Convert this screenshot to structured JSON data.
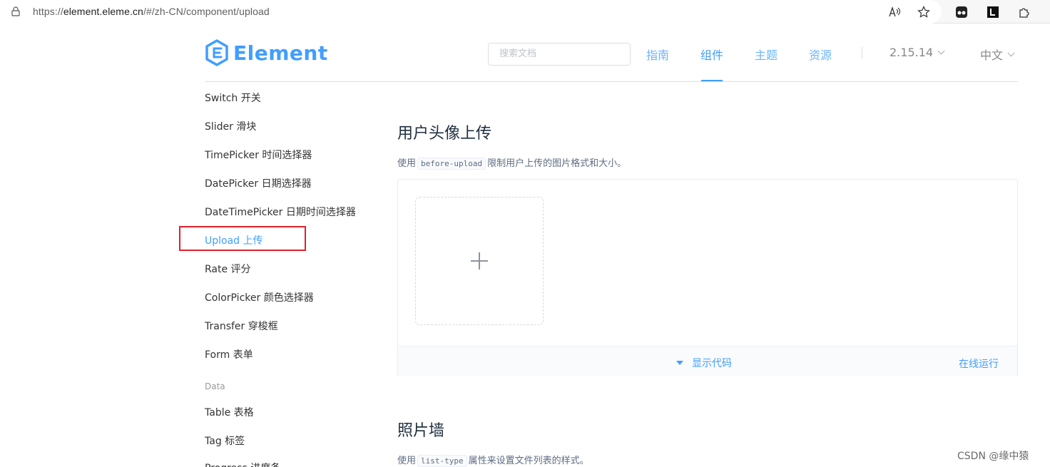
{
  "browser": {
    "url_prefix": "https://",
    "url_host": "element.eleme.cn",
    "url_path": "/#/zh-CN/component/upload",
    "icons": [
      "lock-icon",
      "read-aloud-icon",
      "favorite-star-icon",
      "extension-icon",
      "extension-icon",
      "puzzle-extension-icon"
    ]
  },
  "header": {
    "logo_text": "Element",
    "search_placeholder": "搜索文档",
    "nav": [
      {
        "label": "指南"
      },
      {
        "label": "组件"
      },
      {
        "label": "主题"
      },
      {
        "label": "资源"
      }
    ],
    "active_nav": "组件",
    "version": "2.15.14",
    "language": "中文",
    "accent_color": "#409eff"
  },
  "sidebar": {
    "items": [
      {
        "label": "Switch 开关"
      },
      {
        "label": "Slider 滑块"
      },
      {
        "label": "TimePicker 时间选择器"
      },
      {
        "label": "DatePicker 日期选择器"
      },
      {
        "label": "DateTimePicker 日期时间选择器"
      },
      {
        "label": "Upload 上传"
      },
      {
        "label": "Rate 评分"
      },
      {
        "label": "ColorPicker 颜色选择器"
      },
      {
        "label": "Transfer 穿梭框"
      },
      {
        "label": "Form 表单"
      }
    ],
    "group_label": "Data",
    "group_items": [
      {
        "label": "Table 表格"
      },
      {
        "label": "Tag 标签"
      },
      {
        "label": "Progress 进度条"
      }
    ],
    "active_item": "Upload 上传"
  },
  "main": {
    "section1": {
      "title": "用户头像上传",
      "desc_before": "使用",
      "desc_code": "before-upload",
      "desc_after": "限制用户上传的图片格式和大小。",
      "show_code": "显示代码",
      "run_online": "在线运行"
    },
    "section2": {
      "title": "照片墙",
      "desc_before": "使用",
      "desc_code": "list-type",
      "desc_after": "属性来设置文件列表的样式。"
    }
  },
  "watermark": "CSDN @缘中猿"
}
